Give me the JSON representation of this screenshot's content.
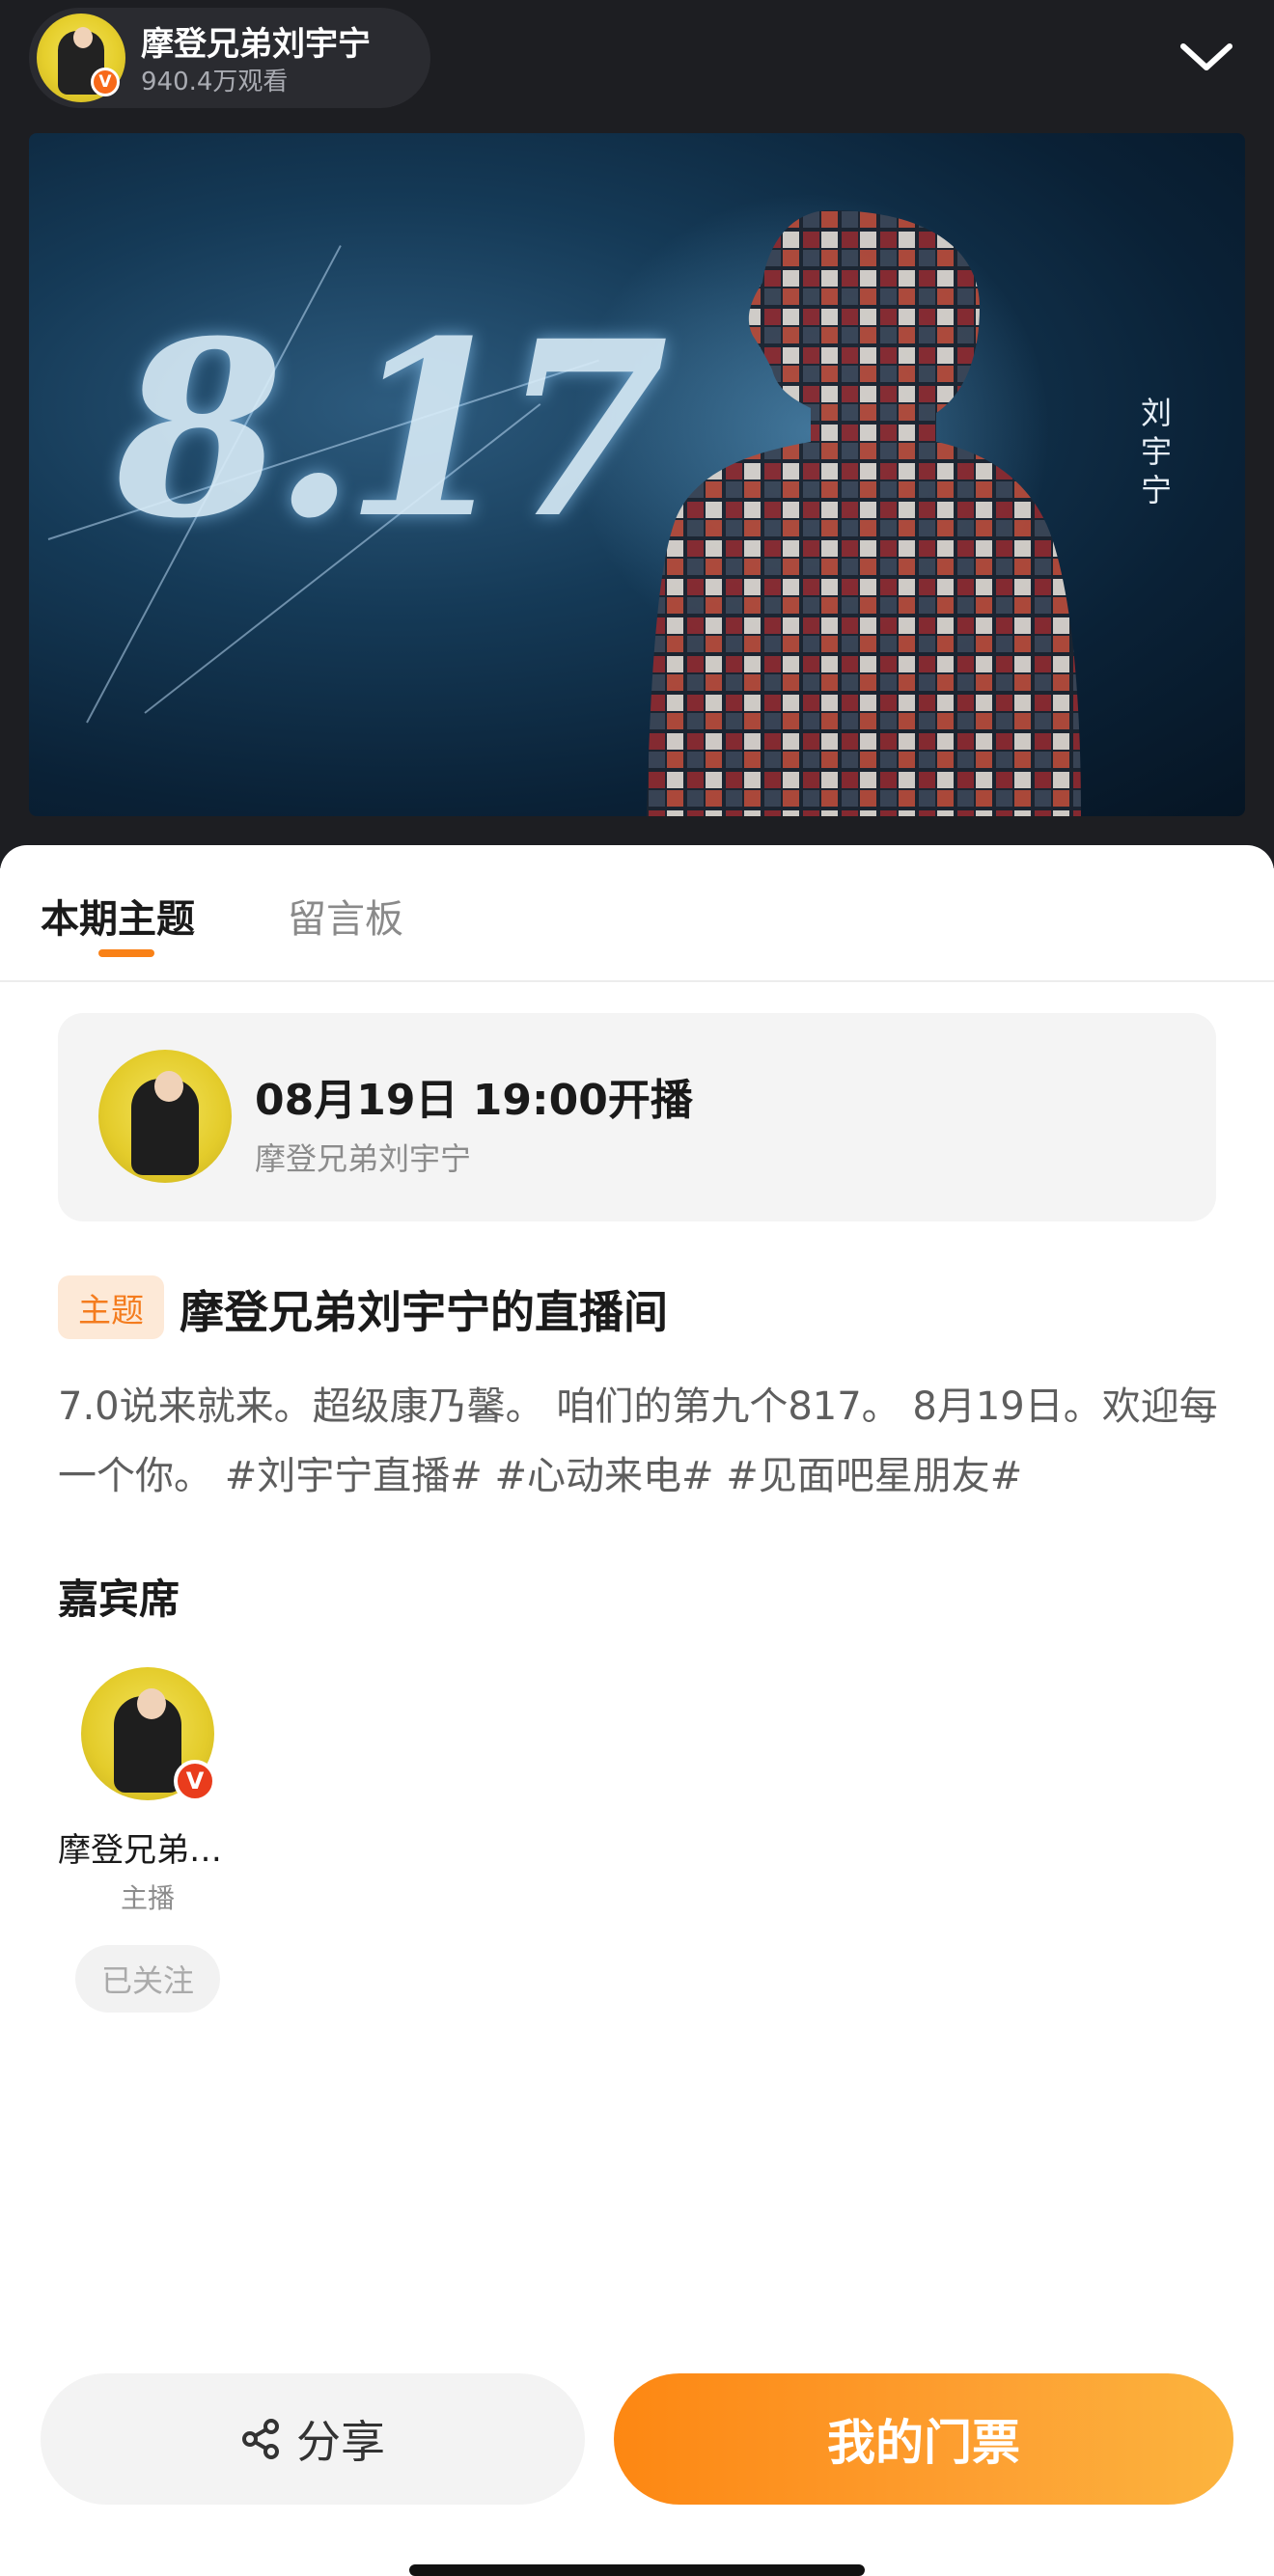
{
  "header": {
    "host_name": "摩登兄弟刘宇宁",
    "views": "940.4万观看",
    "verified_mark": "V"
  },
  "poster": {
    "big_text": "8.17",
    "side_text": "刘宇宁"
  },
  "tabs": [
    {
      "label": "本期主题",
      "active": true
    },
    {
      "label": "留言板",
      "active": false
    }
  ],
  "schedule": {
    "time": "08月19日 19:00开播",
    "host": "摩登兄弟刘宇宁"
  },
  "theme": {
    "tag": "主题",
    "title": "摩登兄弟刘宇宁的直播间",
    "description": "7.0说来就来。超级康乃馨。 咱们的第九个817。 8月19日。欢迎每一个你。 #刘宇宁直播# #心动来电# #见面吧星朋友#"
  },
  "guests": {
    "title": "嘉宾席",
    "items": [
      {
        "name": "摩登兄弟…",
        "role": "主播",
        "follow_label": "已关注",
        "badge": "V"
      }
    ]
  },
  "actions": {
    "share_label": "分享",
    "ticket_label": "我的门票"
  },
  "colors": {
    "accent": "#f98117",
    "ticket_gradient_start": "#fd8712",
    "ticket_gradient_end": "#fcb43e",
    "top_background": "#1d1e22"
  }
}
